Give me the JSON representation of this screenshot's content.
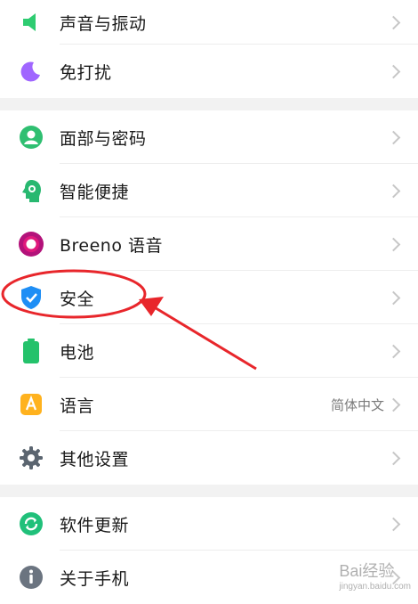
{
  "groups": [
    {
      "items": [
        {
          "label": "声音与振动",
          "icon": "speaker-icon"
        },
        {
          "label": "免打扰",
          "icon": "moon-icon"
        }
      ]
    },
    {
      "items": [
        {
          "label": "面部与密码",
          "icon": "face-lock-icon"
        },
        {
          "label": "智能便捷",
          "icon": "smart-head-icon"
        },
        {
          "label": "Breeno 语音",
          "icon": "breeno-icon"
        },
        {
          "label": "安全",
          "icon": "shield-icon"
        },
        {
          "label": "电池",
          "icon": "battery-icon"
        },
        {
          "label": "语言",
          "icon": "language-icon",
          "value": "简体中文"
        },
        {
          "label": "其他设置",
          "icon": "gear-icon"
        }
      ]
    },
    {
      "items": [
        {
          "label": "软件更新",
          "icon": "update-icon"
        },
        {
          "label": "关于手机",
          "icon": "info-icon"
        }
      ]
    }
  ],
  "annotation": {
    "highlight_color": "#e8262b",
    "highlight_target": "安全"
  },
  "watermark": {
    "brand": "Bai经验",
    "url": "jingyan.baidu.com"
  }
}
